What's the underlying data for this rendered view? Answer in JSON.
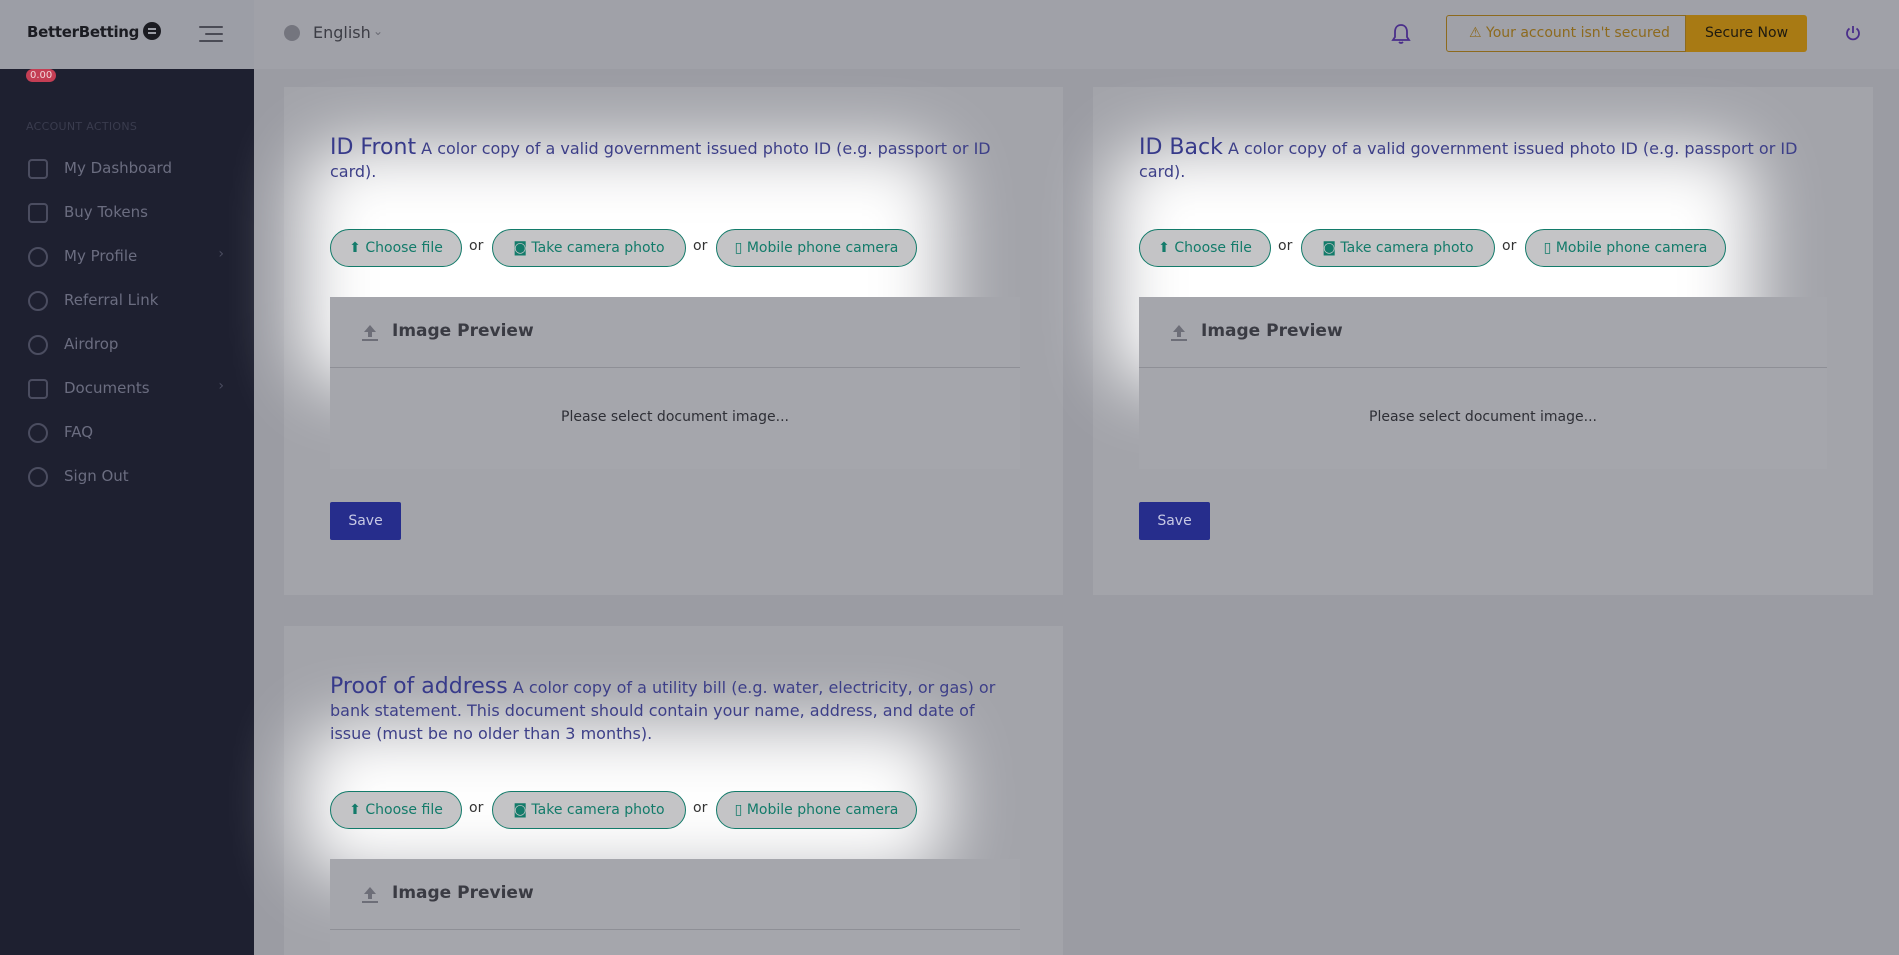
{
  "brand": {
    "name": "BetterBetting"
  },
  "balance": "0.00",
  "sidebar": {
    "section_label": "ACCOUNT ACTIONS",
    "items": [
      {
        "label": "My Dashboard",
        "icon": "dashboard-icon"
      },
      {
        "label": "Buy Tokens",
        "icon": "money-icon"
      },
      {
        "label": "My Profile",
        "icon": "user-icon",
        "chevron": "›"
      },
      {
        "label": "Referral Link",
        "icon": "link-icon"
      },
      {
        "label": "Airdrop",
        "icon": "cloud-download-icon"
      },
      {
        "label": "Documents",
        "icon": "document-icon",
        "chevron": "›"
      },
      {
        "label": "FAQ",
        "icon": "question-icon"
      },
      {
        "label": "Sign Out",
        "icon": "power-icon"
      }
    ]
  },
  "topbar": {
    "language": "English",
    "language_chevron": "⌄",
    "warning_icon": "⚠",
    "warning_text": "Your account isn't secured",
    "secure_button": "Secure Now"
  },
  "cards": [
    {
      "title": "ID Front",
      "description": "A color copy of a valid government issued photo ID (e.g. passport or ID card).",
      "choose_file": "Choose file",
      "take_photo": "Take camera photo",
      "mobile_camera": "Mobile phone camera",
      "or": "or",
      "preview_title": "Image Preview",
      "preview_message": "Please select document image...",
      "save": "Save"
    },
    {
      "title": "ID Back",
      "description": "A color copy of a valid government issued photo ID (e.g. passport or ID card).",
      "choose_file": "Choose file",
      "take_photo": "Take camera photo",
      "mobile_camera": "Mobile phone camera",
      "or": "or",
      "preview_title": "Image Preview",
      "preview_message": "Please select document image...",
      "save": "Save"
    },
    {
      "title": "Proof of address",
      "description": "A color copy of a utility bill (e.g. water, electricity, or gas) or bank statement. This document should contain your name, address, and date of issue (must be no older than 3 months).",
      "choose_file": "Choose file",
      "take_photo": "Take camera photo",
      "mobile_camera": "Mobile phone camera",
      "or": "or",
      "preview_title": "Image Preview"
    }
  ],
  "colors": {
    "sidebar": "#1e2030",
    "accent_green": "#137b6a",
    "primary_blue": "#262d8c",
    "warning": "#a87a14",
    "title_purple": "#373a8a"
  }
}
